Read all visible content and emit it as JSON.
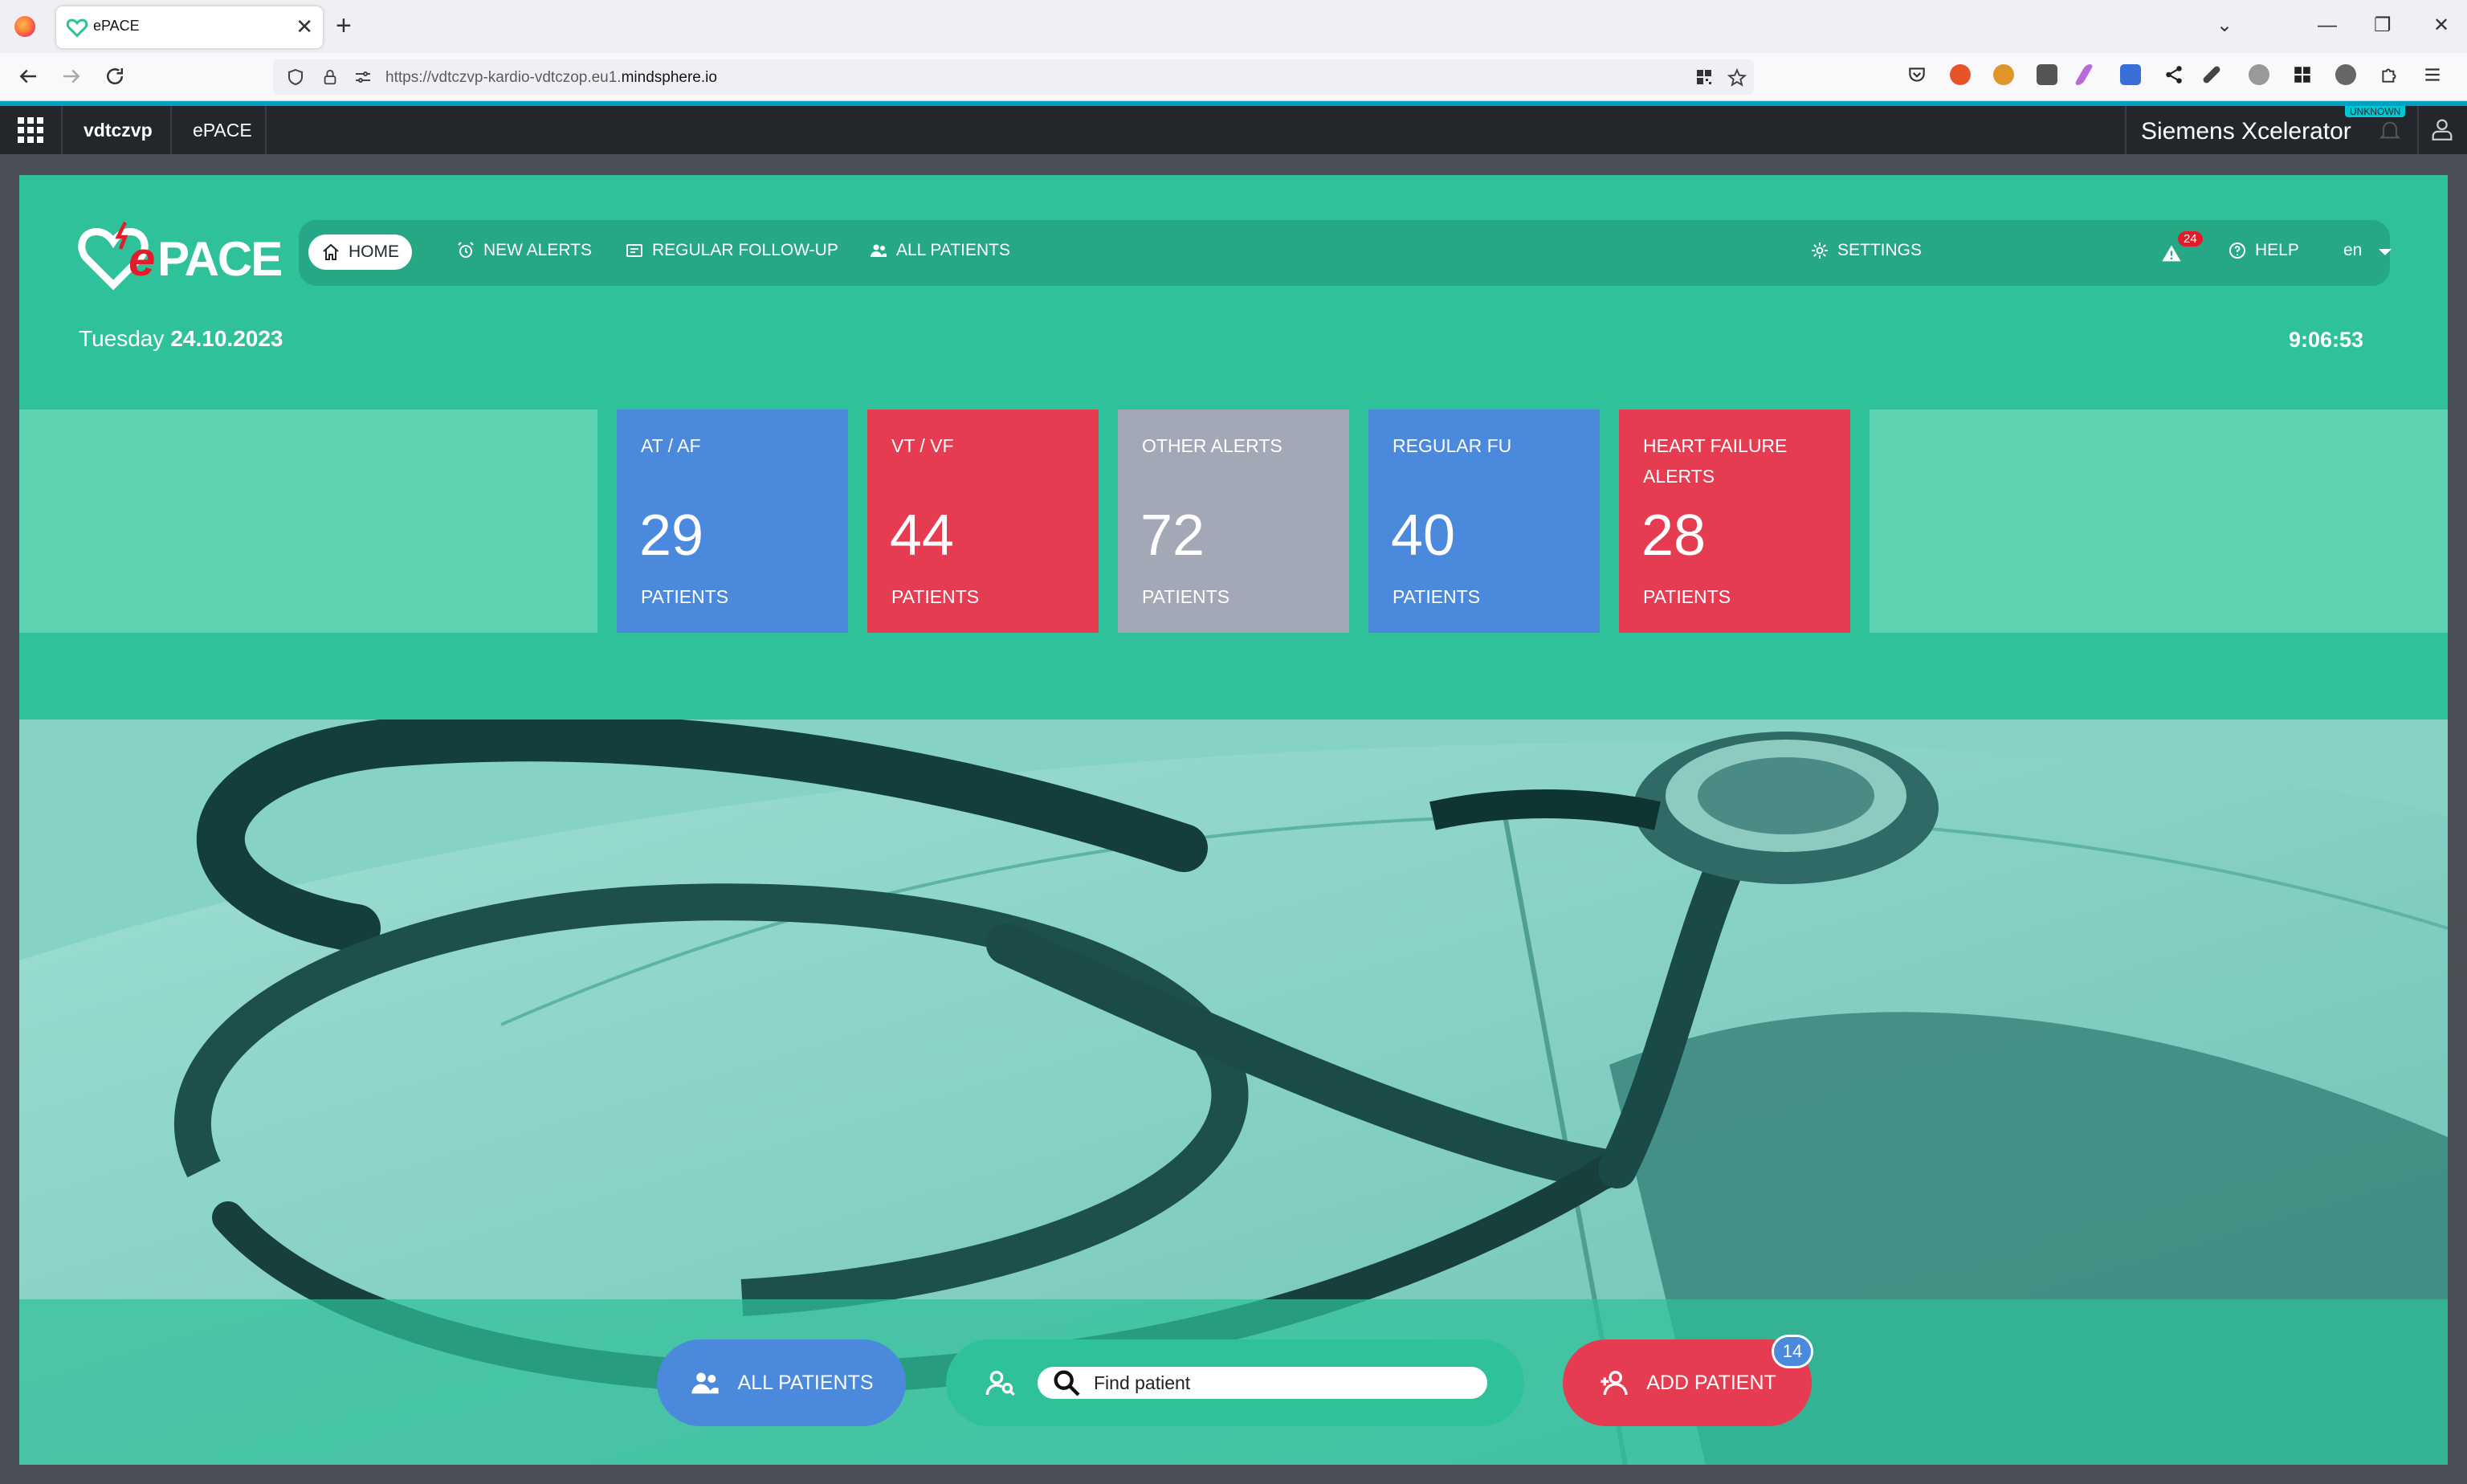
{
  "browser": {
    "tab_title": "ePACE",
    "close_glyph": "✕",
    "new_tab_glyph": "+",
    "url_prefix": "https://vdtczvp-kardio-vdtczop.eu1.",
    "url_host": "mindsphere.io",
    "window_controls": [
      "⌄",
      "—",
      "❐",
      "✕"
    ]
  },
  "appbar": {
    "tenant": "vdtczvp",
    "app": "ePACE",
    "brand": "Siemens Xcelerator",
    "env_tag": "UNKNOWN"
  },
  "app": {
    "logo_text": "PACE",
    "logo_e": "e",
    "nav": {
      "home": "HOME",
      "new_alerts": "NEW ALERTS",
      "regular_follow_up": "REGULAR FOLLOW-UP",
      "all_patients": "ALL PATIENTS",
      "settings": "SETTINGS",
      "alerts_count": "24",
      "help": "HELP",
      "language": "en"
    },
    "day": "Tuesday",
    "date": "24.10.2023",
    "time": "9:06:53",
    "cards": [
      {
        "title": "AT / AF",
        "count": "29",
        "unit": "PATIENTS",
        "color": "#4a89dc"
      },
      {
        "title": "VT / VF",
        "count": "44",
        "unit": "PATIENTS",
        "color": "#e63c52"
      },
      {
        "title": "OTHER ALERTS",
        "count": "72",
        "unit": "PATIENTS",
        "color": "#a2a8b6"
      },
      {
        "title": "REGULAR FU",
        "count": "40",
        "unit": "PATIENTS",
        "color": "#4a89dc"
      },
      {
        "title": "HEART FAILURE ALERTS",
        "count": "28",
        "unit": "PATIENTS",
        "color": "#e63c52"
      }
    ],
    "actions": {
      "all_patients": "ALL PATIENTS",
      "find_placeholder": "Find patient",
      "add_patient": "ADD PATIENT",
      "add_badge": "14"
    }
  },
  "colors": {
    "app_bg": "#2fc19a",
    "nav_bg": "#26a887",
    "blue": "#4a89dc",
    "red": "#e63c52",
    "gray": "#a2a8b6"
  }
}
